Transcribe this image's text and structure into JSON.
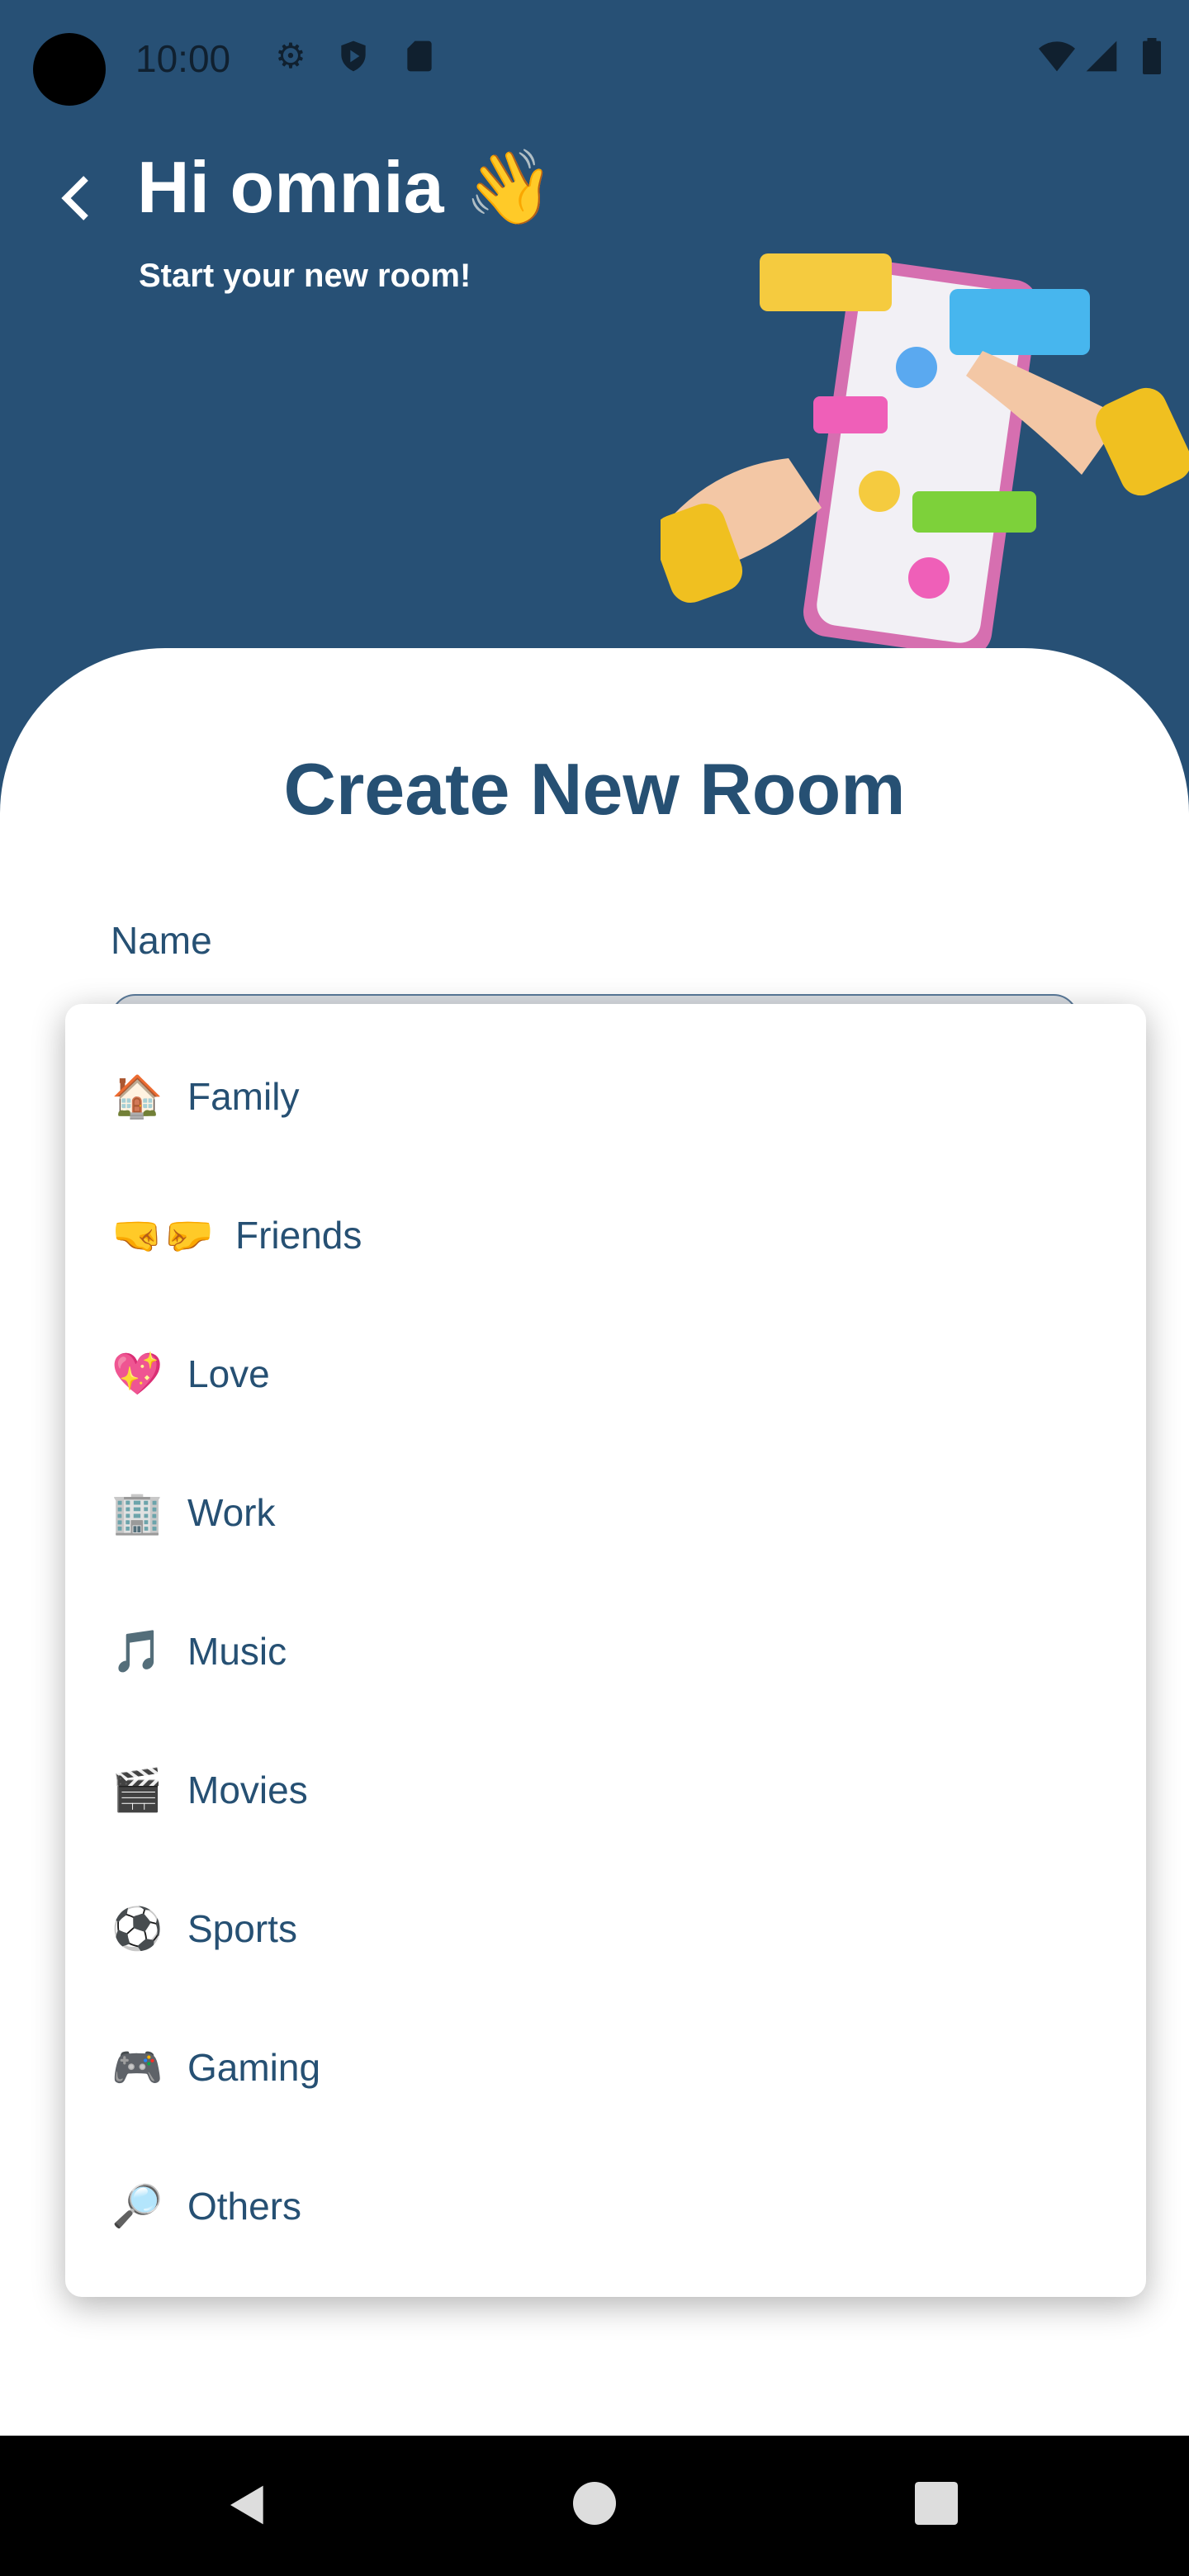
{
  "status_bar": {
    "time": "10:00",
    "icons": [
      "settings-icon",
      "shield-play-icon",
      "sd-card-icon",
      "wifi-icon",
      "signal-icon",
      "battery-icon"
    ]
  },
  "header": {
    "title": "Hi omnia 👋",
    "subtitle": "Start your new room!"
  },
  "form": {
    "title": "Create New Room",
    "name_label": "Name",
    "name_value": ""
  },
  "menu": {
    "items": [
      {
        "icon": "🏠",
        "label": "Family"
      },
      {
        "icon": "🤜🤛",
        "label": "Friends"
      },
      {
        "icon": "💖",
        "label": "Love"
      },
      {
        "icon": "🏢",
        "label": "Work"
      },
      {
        "icon": "🎵",
        "label": "Music"
      },
      {
        "icon": "🎬",
        "label": "Movies"
      },
      {
        "icon": "⚽",
        "label": "Sports"
      },
      {
        "icon": "🎮",
        "label": "Gaming"
      },
      {
        "icon": "🔎",
        "label": "Others"
      }
    ]
  },
  "colors": {
    "header_bg": "#275075",
    "accent": "#265073"
  }
}
